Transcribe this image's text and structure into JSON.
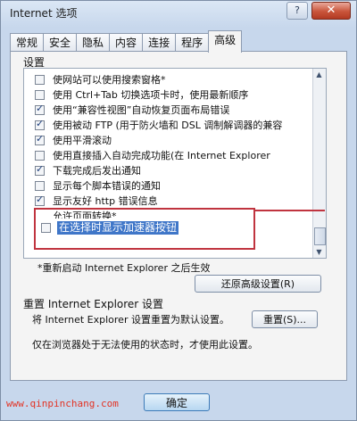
{
  "window": {
    "title": "Internet 选项",
    "help_label": "?",
    "close_label": "✕"
  },
  "tabs": [
    {
      "label": "常规"
    },
    {
      "label": "安全"
    },
    {
      "label": "隐私"
    },
    {
      "label": "内容"
    },
    {
      "label": "连接"
    },
    {
      "label": "程序"
    },
    {
      "label": "高级"
    }
  ],
  "settings": {
    "group_label": "设置",
    "items": [
      {
        "label": "使网站可以使用搜索窗格*",
        "checked": false
      },
      {
        "label": "使用 Ctrl+Tab 切换选项卡时，使用最新顺序",
        "checked": false
      },
      {
        "label": "使用“兼容性视图”自动恢复页面布局错误",
        "checked": true
      },
      {
        "label": "使用被动 FTP (用于防火墙和 DSL 调制解调器的兼容",
        "checked": true
      },
      {
        "label": "使用平滑滚动",
        "checked": true
      },
      {
        "label": "使用直接插入自动完成功能(在 Internet Explorer",
        "checked": false
      },
      {
        "label": "下载完成后发出通知",
        "checked": true
      },
      {
        "label": "显示每个脚本错误的通知",
        "checked": false
      },
      {
        "label": "显示友好 http 错误信息",
        "checked": true
      },
      {
        "label": "允许页面转换*",
        "checked": true
      }
    ],
    "highlight_item": {
      "label": "在选择时显示加速器按钮",
      "checked": false
    }
  },
  "restart_note": "*重新启动 Internet Explorer 之后生效",
  "restore_button": "还原高级设置(R)",
  "reset_section": {
    "title": "重置 Internet Explorer 设置",
    "desc": "将 Internet Explorer 设置重置为默认设置。",
    "button": "重置(S)...",
    "note": "仅在浏览器处于无法使用的状态时，才使用此设置。"
  },
  "footer": {
    "url": "www.qinpinchang.com",
    "ok_button": "确定"
  },
  "colors": {
    "highlight": "#3f76c8",
    "annotation": "#c0343f",
    "watermark": "#e33324"
  }
}
